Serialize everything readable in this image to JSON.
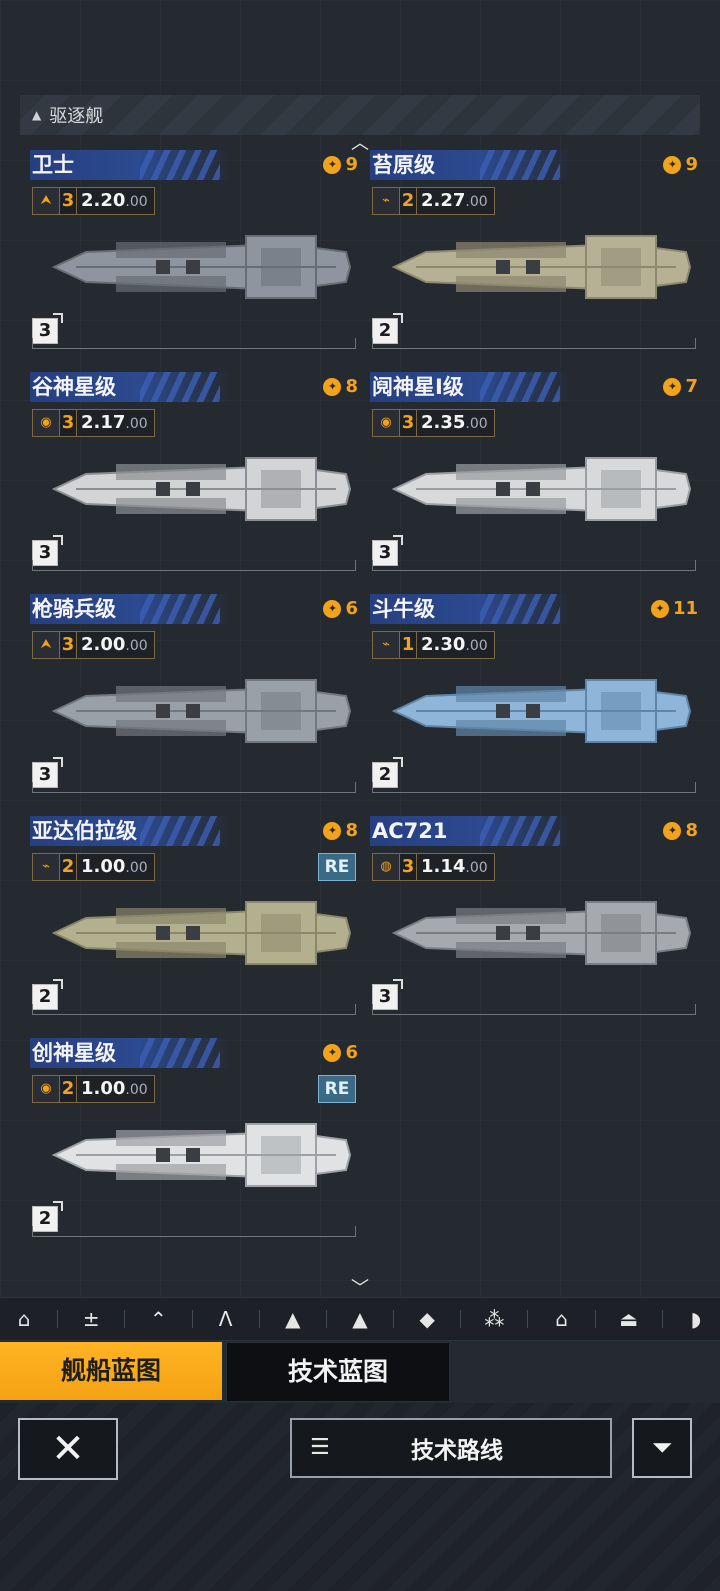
{
  "category": {
    "icon": "tier-triangle-icon",
    "label": "驱逐舰"
  },
  "ships": [
    {
      "name": "卫士",
      "cost": "9",
      "role_icon": "fighter-icon",
      "tier": "3",
      "version_main": "2.20",
      "version_sub": ".00",
      "grade": "3",
      "re": "",
      "hull": "#8f959e",
      "accent": "#676d75"
    },
    {
      "name": "苔原级",
      "cost": "9",
      "role_icon": "wing-icon",
      "tier": "2",
      "version_main": "2.27",
      "version_sub": ".00",
      "grade": "2",
      "re": "",
      "hull": "#b6b095",
      "accent": "#8d8870"
    },
    {
      "name": "谷神星级",
      "cost": "8",
      "role_icon": "cannon-icon",
      "tier": "3",
      "version_main": "2.17",
      "version_sub": ".00",
      "grade": "3",
      "re": "",
      "hull": "#d2d4d6",
      "accent": "#8b8e92"
    },
    {
      "name": "阋神星I级",
      "cost": "7",
      "role_icon": "cannon-icon",
      "tier": "3",
      "version_main": "2.35",
      "version_sub": ".00",
      "grade": "3",
      "re": "",
      "hull": "#d7d9db",
      "accent": "#9a9da1"
    },
    {
      "name": "枪骑兵级",
      "cost": "6",
      "role_icon": "fighter-icon",
      "tier": "3",
      "version_main": "2.00",
      "version_sub": ".00",
      "grade": "3",
      "re": "",
      "hull": "#9aa0a8",
      "accent": "#72787f"
    },
    {
      "name": "斗牛级",
      "cost": "11",
      "role_icon": "wing-icon",
      "tier": "1",
      "version_main": "2.30",
      "version_sub": ".00",
      "grade": "2",
      "re": "",
      "hull": "#8fb6d8",
      "accent": "#5f86a8"
    },
    {
      "name": "亚达伯拉级",
      "cost": "8",
      "role_icon": "wing-icon",
      "tier": "2",
      "version_main": "1.00",
      "version_sub": ".00",
      "grade": "2",
      "re": "RE",
      "hull": "#b3b08f",
      "accent": "#8a876b"
    },
    {
      "name": "AC721",
      "cost": "8",
      "role_icon": "globe-icon",
      "tier": "3",
      "version_main": "1.14",
      "version_sub": ".00",
      "grade": "3",
      "re": "",
      "hull": "#a6a9ad",
      "accent": "#7a7d81"
    },
    {
      "name": "创神星级",
      "cost": "6",
      "role_icon": "cannon-icon",
      "tier": "2",
      "version_main": "1.00",
      "version_sub": ".00",
      "grade": "2",
      "re": "RE",
      "hull": "#e0e2e4",
      "accent": "#9ea1a5"
    }
  ],
  "filters": [
    "frigate-filter-icon",
    "destroyer-filter-icon",
    "cruiser-filter-icon",
    "battlecruiser-filter-icon",
    "auxiliary-filter-icon",
    "carrier-filter-icon",
    "battleship-filter-icon",
    "corvette-filter-icon",
    "station-filter-icon",
    "support-filter-icon",
    "flagship-filter-icon"
  ],
  "tabs": {
    "ship_blueprint": "舰船蓝图",
    "tech_blueprint": "技术蓝图"
  },
  "buttons": {
    "close": "close-icon",
    "tech_route": "技术路线",
    "filter": "filter-icon"
  },
  "colors": {
    "accent_orange": "#f3a214",
    "banner_blue": "#2c4a90",
    "re_badge": "#3a6a85"
  }
}
